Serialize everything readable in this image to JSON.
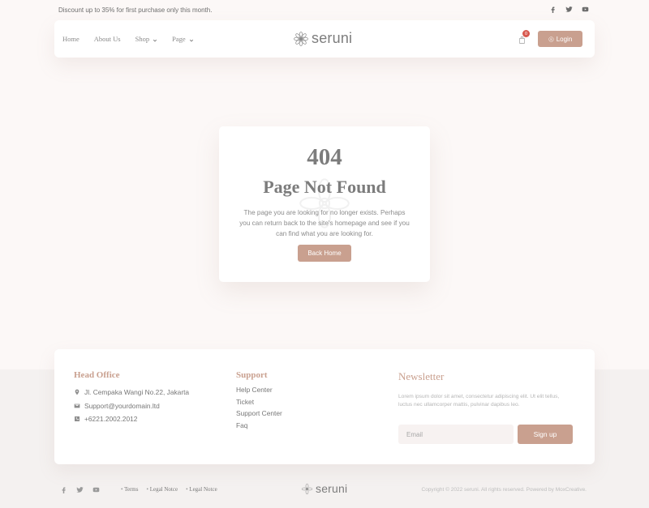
{
  "topbar": {
    "promo": "Discount up to 35% for first purchase only this month.",
    "social": [
      "facebook-icon",
      "twitter-icon",
      "youtube-icon"
    ]
  },
  "nav": {
    "items": [
      {
        "label": "Home",
        "dropdown": false
      },
      {
        "label": "About Us",
        "dropdown": false
      },
      {
        "label": "Shop",
        "dropdown": true
      },
      {
        "label": "Page",
        "dropdown": true
      }
    ],
    "logo_text": "seruni",
    "cart_count": "0",
    "login_label": "Login"
  },
  "error": {
    "code": "404",
    "title": "Page Not Found",
    "message": "The page you are looking for no longer exists. Perhaps you can return back to the site's homepage and see if you can find what you are looking for.",
    "button_label": "Back Home"
  },
  "footer": {
    "office_title": "Head Office",
    "office_items": [
      {
        "icon": "location-icon",
        "text": "Jl. Cempaka Wangi No.22, Jakarta"
      },
      {
        "icon": "mail-icon",
        "text": "Support@yourdomain.ltd"
      },
      {
        "icon": "phone-icon",
        "text": "+6221.2002.2012"
      }
    ],
    "support_title": "Support",
    "support_items": [
      "Help Center",
      "Ticket",
      "Support Center",
      "Faq"
    ],
    "newsletter_title": "Newsletter",
    "newsletter_text": "Lorem ipsum dolor sit amet, consectetur adipiscing elit. Ut elit tellus, luctus nec ullamcorper mattis, pulvinar dapibus leo.",
    "email_placeholder": "Email",
    "signup_label": "Sign up"
  },
  "bottom": {
    "links": [
      "Terms",
      "Legal Notce",
      "Legal Notce"
    ],
    "logo_text": "seruni",
    "copyright": "Copyright © 2022 seruni. All rights reserved. Powered by MoxCreative."
  },
  "colors": {
    "accent": "#c9a08f",
    "badge": "#d7584e",
    "background": "#fcf8f7"
  }
}
